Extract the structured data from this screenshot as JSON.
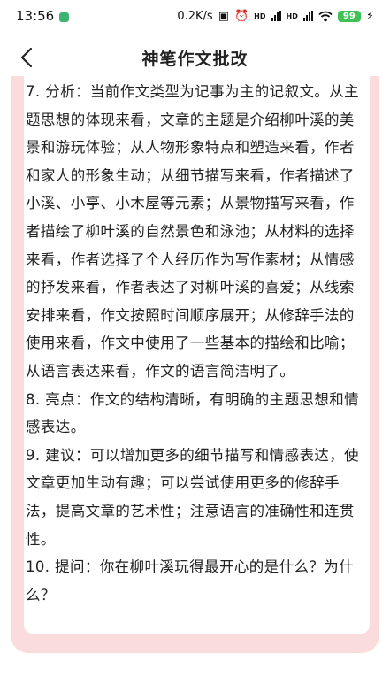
{
  "status": {
    "time": "13:56",
    "speed": "0.2K/s",
    "net_a": "HD",
    "net_b": "HD",
    "battery": "99"
  },
  "nav": {
    "title": "神笔作文批改"
  },
  "review": {
    "items": [
      "7. 分析：当前作文类型为记事为主的记叙文。从主题思想的体现来看，文章的主题是介绍柳叶溪的美景和游玩体验；从人物形象特点和塑造来看，作者和家人的形象生动；从细节描写来看，作者描述了小溪、小亭、小木屋等元素；从景物描写来看，作者描绘了柳叶溪的自然景色和泳池；从材料的选择来看，作者选择了个人经历作为写作素材；从情感的抒发来看，作者表达了对柳叶溪的喜爱；从线索安排来看，作文按照时间顺序展开；从修辞手法的使用来看，作文中使用了一些基本的描绘和比喻；从语言表达来看，作文的语言简洁明了。",
      "8. 亮点：作文的结构清晰，有明确的主题思想和情感表达。",
      "9. 建议：可以增加更多的细节描写和情感表达，使文章更加生动有趣；可以尝试使用更多的修辞手法，提高文章的艺术性；注意语言的准确性和连贯性。",
      "10. 提问：你在柳叶溪玩得最开心的是什么？为什么？"
    ]
  }
}
